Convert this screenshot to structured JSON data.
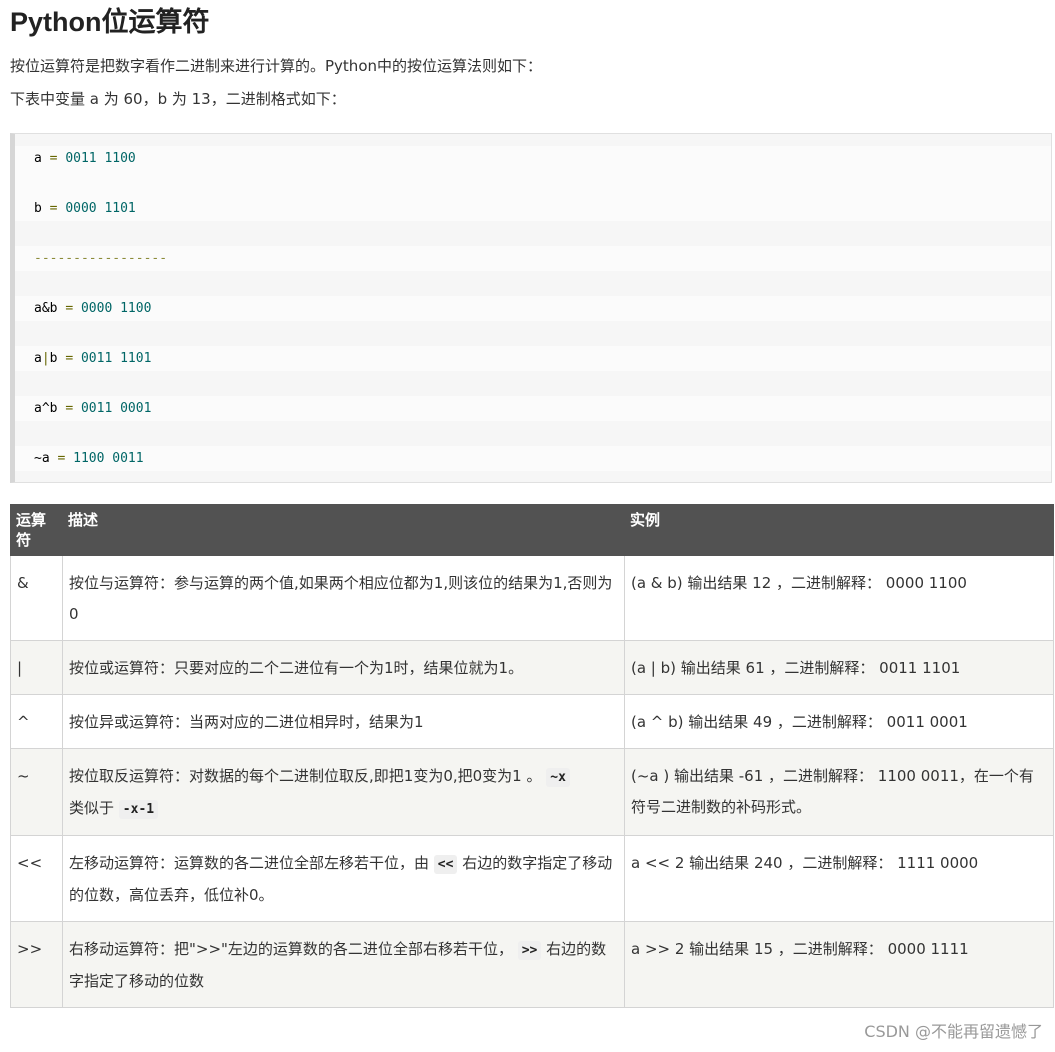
{
  "title": "Python位运算符",
  "intro": "按位运算符是把数字看作二进制来进行计算的。Python中的按位运算法则如下：",
  "intro2": "下表中变量 a 为 60，b 为 13，二进制格式如下：",
  "code": {
    "a_var": "a",
    "a_val": "0011 1100",
    "b_var": "b",
    "b_val": "0000 1101",
    "dashes": "-----------------",
    "and_expr": "a&b",
    "and_val": "0000 1100",
    "or_expr_a": "a",
    "or_expr_b": "b",
    "or_val": "0011 1101",
    "xor_expr": "a^b",
    "xor_val": "0011 0001",
    "not_expr": "~a ",
    "not_val": "1100 0011",
    "eq": "="
  },
  "table": {
    "headers": [
      "运算符",
      "描述",
      "实例"
    ],
    "rows": [
      {
        "op": "&",
        "desc": "按位与运算符：参与运算的两个值,如果两个相应位都为1,则该位的结果为1,否则为0",
        "example": "(a & b) 输出结果 12 ，二进制解释： 0000 1100"
      },
      {
        "op": "|",
        "desc": "按位或运算符：只要对应的二个二进位有一个为1时，结果位就为1。",
        "example": "(a | b) 输出结果 61 ，二进制解释： 0011 1101"
      },
      {
        "op": "^",
        "desc": "按位异或运算符：当两对应的二进位相异时，结果为1",
        "example": "(a ^ b) 输出结果 49 ，二进制解释： 0011 0001"
      },
      {
        "op": "~",
        "desc_a": "按位取反运算符：对数据的每个二进制位取反,即把1变为0,把0变为1 。",
        "desc_code1": "~x",
        "desc_b": "类似于",
        "desc_code2": "-x-1",
        "example": "(~a ) 输出结果 -61 ，二进制解释： 1100 0011，在一个有符号二进制数的补码形式。"
      },
      {
        "op": "<<",
        "desc_a": "左移动运算符：运算数的各二进位全部左移若干位，由",
        "desc_code": "<<",
        "desc_b": "右边的数字指定了移动的位数，高位丢弃，低位补0。",
        "example": "a << 2 输出结果 240 ，二进制解释： 1111 0000"
      },
      {
        "op": ">>",
        "desc_a": "右移动运算符：把\">>\"左边的运算数的各二进位全部右移若干位，",
        "desc_code": ">>",
        "desc_b": "右边的数字指定了移动的位数",
        "example": "a >> 2 输出结果 15 ，二进制解释： 0000 1111"
      }
    ]
  },
  "watermark": "CSDN @不能再留遗憾了"
}
